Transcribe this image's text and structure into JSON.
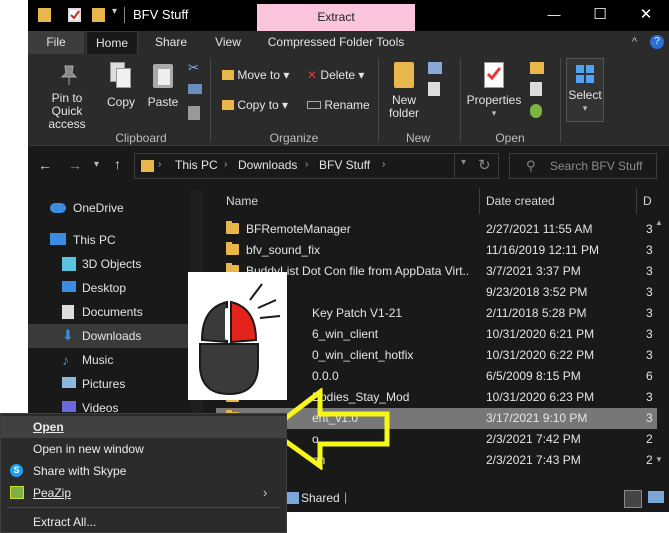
{
  "window": {
    "title": "BFV Stuff",
    "context_tab": "Extract",
    "buttons": {
      "minimize": "—",
      "maximize": "☐",
      "close": "✕"
    }
  },
  "ribbon_tabs": [
    "File",
    "Home",
    "Share",
    "View",
    "Compressed Folder Tools"
  ],
  "ribbon": {
    "clipboard": {
      "pin": "Pin to Quick access",
      "copy": "Copy",
      "paste": "Paste",
      "group": "Clipboard"
    },
    "organize": {
      "move_to": "Move to",
      "copy_to": "Copy to",
      "delete": "Delete",
      "rename": "Rename",
      "group": "Organize"
    },
    "new": {
      "new_folder": "New folder",
      "group": "New"
    },
    "open": {
      "properties": "Properties",
      "group": "Open"
    },
    "select": {
      "label": "Select"
    }
  },
  "address": {
    "crumbs": [
      "This PC",
      "Downloads",
      "BFV Stuff"
    ],
    "search_placeholder": "Search BFV Stuff"
  },
  "nav": [
    {
      "label": "OneDrive",
      "icon": "cloud-icon"
    },
    {
      "label": "This PC",
      "icon": "computer-icon"
    },
    {
      "label": "3D Objects",
      "icon": "cube-icon"
    },
    {
      "label": "Desktop",
      "icon": "desktop-icon"
    },
    {
      "label": "Documents",
      "icon": "document-icon"
    },
    {
      "label": "Downloads",
      "icon": "download-icon"
    },
    {
      "label": "Music",
      "icon": "music-icon"
    },
    {
      "label": "Pictures",
      "icon": "picture-icon"
    },
    {
      "label": "Videos",
      "icon": "video-icon"
    }
  ],
  "columns": {
    "name": "Name",
    "date": "Date created",
    "extra": "D"
  },
  "files": [
    {
      "name": "BFRemoteManager",
      "date": "2/27/2021 11:55 AM",
      "extra": "3"
    },
    {
      "name": "bfv_sound_fix",
      "date": "11/16/2019 12:11 PM",
      "extra": "3"
    },
    {
      "name": "BuddyList Dot Con file from AppData Virt...",
      "date": "3/7/2021 3:37 PM",
      "extra": "3"
    },
    {
      "name": "",
      "date": "9/23/2018 3:52 PM",
      "extra": "3"
    },
    {
      "name": "Key Patch V1-21",
      "date": "2/11/2018 5:28 PM",
      "extra": "3"
    },
    {
      "name": "6_win_client",
      "date": "10/31/2020 6:21 PM",
      "extra": "3"
    },
    {
      "name": "0_win_client_hotfix",
      "date": "10/31/2020 6:22 PM",
      "extra": "3"
    },
    {
      "name": "0.0.0",
      "date": "6/5/2009 8:15 PM",
      "extra": "6"
    },
    {
      "name": "Bodies_Stay_Mod",
      "date": "10/31/2020 6:23 PM",
      "extra": "3"
    },
    {
      "name": "ent_v1.0",
      "date": "3/17/2021 9:10 PM",
      "extra": "3"
    },
    {
      "name": "o",
      "date": "2/3/2021 7:42 PM",
      "extra": "2"
    },
    {
      "name": "on",
      "date": "2/3/2021 7:43 PM",
      "extra": "2"
    }
  ],
  "context_menu": [
    {
      "label": "Open",
      "bold": true
    },
    {
      "label": "Open in new window"
    },
    {
      "label": "Share with Skype",
      "icon": "skype-icon"
    },
    {
      "label": "PeaZip",
      "icon": "peazip-icon",
      "submenu": true
    },
    {
      "label": "Extract All..."
    }
  ],
  "status": {
    "shared": "Shared"
  },
  "colors": {
    "accent_selected": "#777777",
    "window_bg": "#191919",
    "ribbon_bg": "#2b2b2b",
    "extract_tab": "#f9c4dc",
    "arrow": "#f7f71a",
    "mouse_red": "#e5231b"
  }
}
